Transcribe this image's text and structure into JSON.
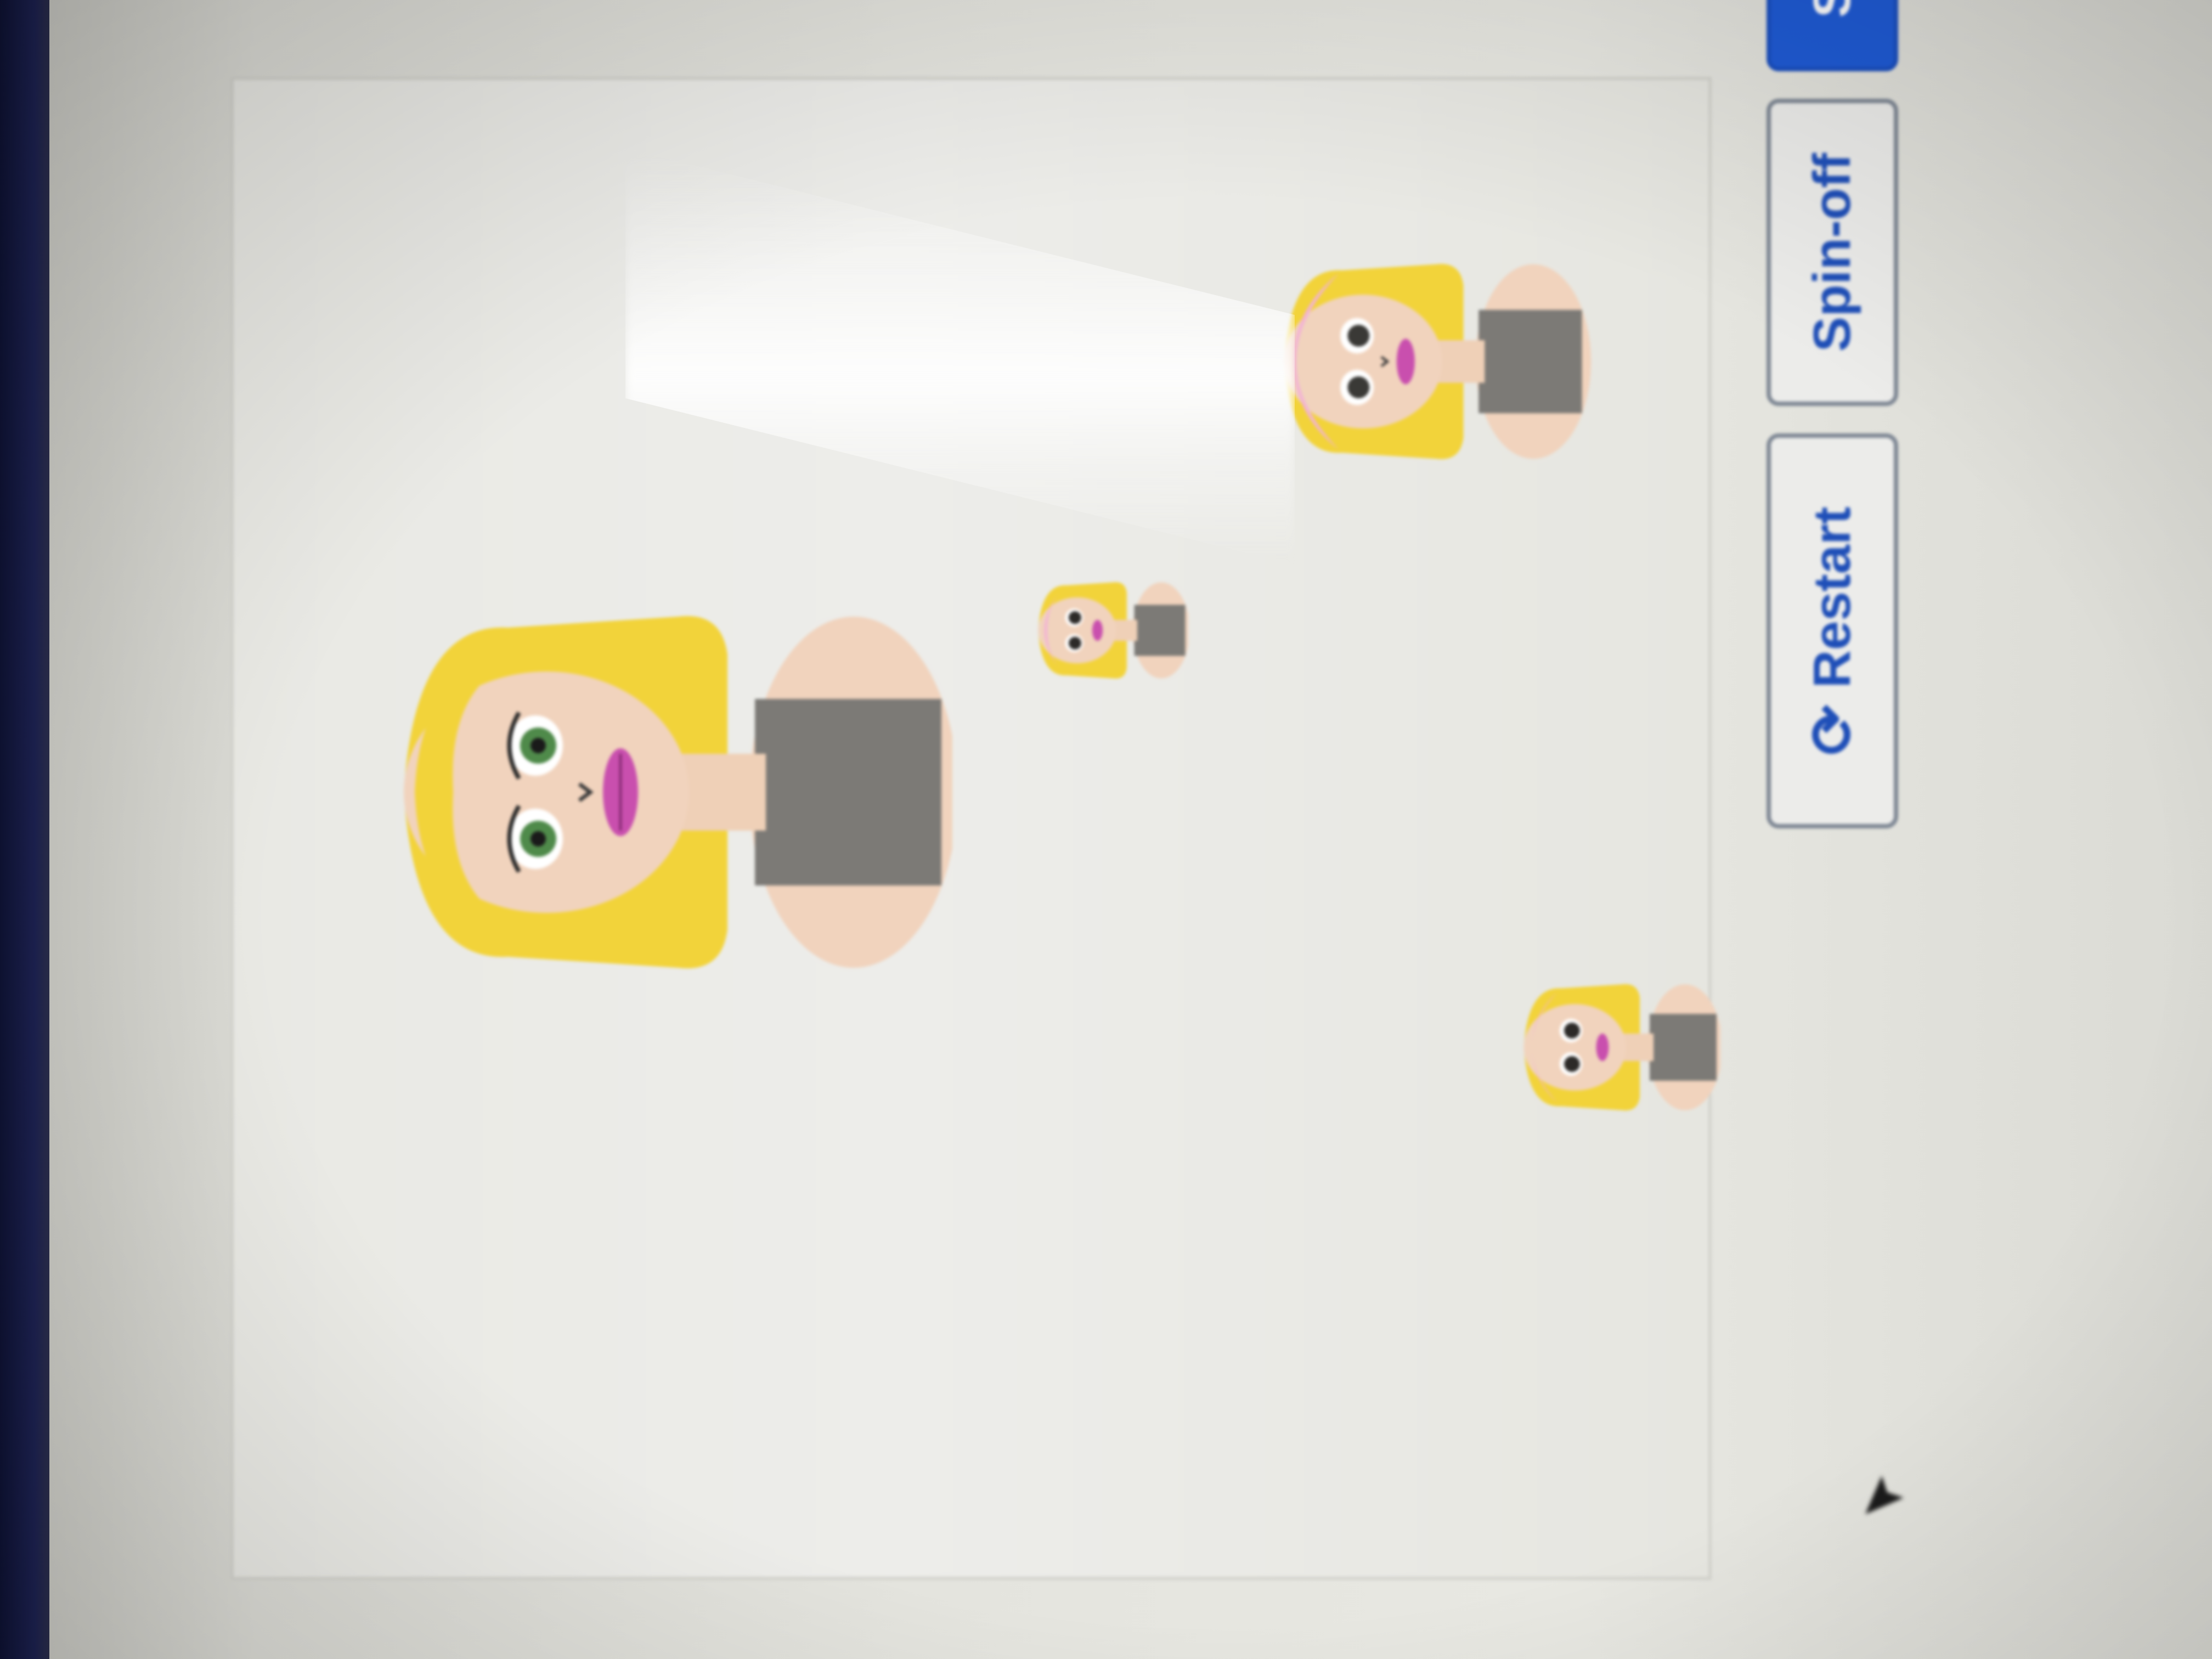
{
  "toolbar": {
    "restart_label": "Restart",
    "spinoff_label": "Spin-off",
    "save_label": "Save",
    "restart_icon": "refresh-icon"
  },
  "colors": {
    "primary": "#1f5bd6",
    "outline_text": "#1f4fb8",
    "hair": "#f2d33a",
    "skin": "#f1d3bd",
    "shirt": "#7c7a76",
    "lips": "#c94fae",
    "eyes": "#4f8a4a",
    "headband": "#f2b3d4"
  },
  "avatars": [
    {
      "name": "large-avatar",
      "headband": false,
      "eye_color": "green"
    },
    {
      "name": "small-avatar-1",
      "headband": false,
      "eye_color": "dark"
    },
    {
      "name": "medium-avatar",
      "headband": true,
      "eye_color": "dark"
    },
    {
      "name": "small-avatar-2",
      "headband": true,
      "eye_color": "dark"
    }
  ]
}
